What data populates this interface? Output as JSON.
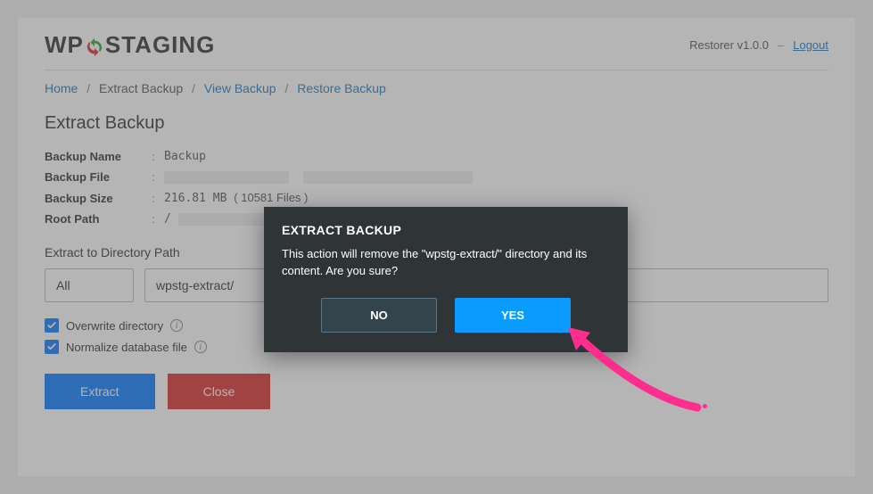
{
  "header": {
    "logo_prefix": "WP",
    "logo_suffix": "STAGING",
    "version_label": "Restorer v",
    "version": "1.0.0",
    "logout": "Logout"
  },
  "breadcrumb": {
    "home": "Home",
    "current": "Extract Backup",
    "view": "View Backup",
    "restore": "Restore Backup",
    "sep": "/"
  },
  "page_title": "Extract Backup",
  "meta": {
    "name_label": "Backup Name",
    "name_value": "Backup",
    "file_label": "Backup File",
    "size_label": "Backup Size",
    "size_value": "216.81 MB",
    "size_files": "( 10581 Files )",
    "root_label": "Root Path",
    "root_value": "/"
  },
  "extract": {
    "section_label": "Extract to Directory Path",
    "mode": "All",
    "path": "wpstg-extract/",
    "overwrite_label": "Overwrite directory",
    "normalize_label": "Normalize database file"
  },
  "buttons": {
    "extract": "Extract",
    "close": "Close"
  },
  "modal": {
    "title": "EXTRACT BACKUP",
    "message": "This action will remove the \"wpstg-extract/\" directory and its content. Are you sure?",
    "no": "NO",
    "yes": "YES"
  }
}
